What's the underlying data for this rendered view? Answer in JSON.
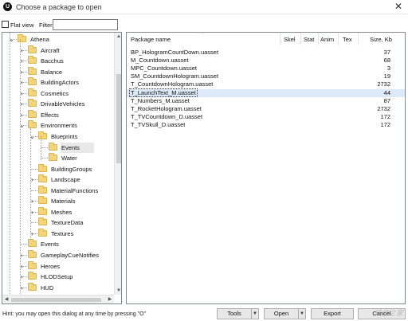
{
  "window": {
    "title": "Choose a package to open",
    "app_icon_glyph": "U"
  },
  "toolbar": {
    "flat_view_label": "Flat view",
    "flat_view_checked": false,
    "filter_label": "Filter",
    "filter_value": ""
  },
  "tree": {
    "items": [
      {
        "label": "Athena",
        "depth": 0,
        "expander": "expanded"
      },
      {
        "label": "Aircraft",
        "depth": 1,
        "expander": "collapsed"
      },
      {
        "label": "Bacchus",
        "depth": 1,
        "expander": "collapsed"
      },
      {
        "label": "Balance",
        "depth": 1,
        "expander": "collapsed"
      },
      {
        "label": "BuildingActors",
        "depth": 1,
        "expander": "collapsed"
      },
      {
        "label": "Cosmetics",
        "depth": 1,
        "expander": "collapsed"
      },
      {
        "label": "DrivableVehicles",
        "depth": 1,
        "expander": "collapsed"
      },
      {
        "label": "Effects",
        "depth": 1,
        "expander": "collapsed"
      },
      {
        "label": "Environments",
        "depth": 1,
        "expander": "expanded"
      },
      {
        "label": "Blueprints",
        "depth": 2,
        "expander": "expanded"
      },
      {
        "label": "Events",
        "depth": 3,
        "expander": "none",
        "selected": true
      },
      {
        "label": "Water",
        "depth": 3,
        "expander": "none"
      },
      {
        "label": "BuildingGroups",
        "depth": 2,
        "expander": "none"
      },
      {
        "label": "Landscape",
        "depth": 2,
        "expander": "collapsed"
      },
      {
        "label": "MaterialFunctions",
        "depth": 2,
        "expander": "none"
      },
      {
        "label": "Materials",
        "depth": 2,
        "expander": "collapsed"
      },
      {
        "label": "Meshes",
        "depth": 2,
        "expander": "collapsed"
      },
      {
        "label": "TextureData",
        "depth": 2,
        "expander": "none"
      },
      {
        "label": "Textures",
        "depth": 2,
        "expander": "collapsed"
      },
      {
        "label": "Events",
        "depth": 1,
        "expander": "none"
      },
      {
        "label": "GameplayCueNotifies",
        "depth": 1,
        "expander": "collapsed"
      },
      {
        "label": "Heroes",
        "depth": 1,
        "expander": "collapsed"
      },
      {
        "label": "HLODSetup",
        "depth": 1,
        "expander": "collapsed"
      },
      {
        "label": "HUD",
        "depth": 1,
        "expander": "collapsed"
      }
    ]
  },
  "list": {
    "columns": {
      "name": "Package name",
      "skel": "Skel",
      "stat": "Stat",
      "anim": "Anim",
      "tex": "Tex",
      "size": "Size, Kb"
    },
    "rows": [
      {
        "name": "BP_HologramCountDown.uasset",
        "size": "37"
      },
      {
        "name": "M_Countdown.uasset",
        "size": "68"
      },
      {
        "name": "MPC_Countdown.uasset",
        "size": "3"
      },
      {
        "name": "SM_CountdownHologram.uasset",
        "size": "19"
      },
      {
        "name": "T_CountdownHologram.uasset",
        "size": "2732"
      },
      {
        "name": "T_LaunchText_M.uasset",
        "size": "44",
        "selected": true
      },
      {
        "name": "T_Numbers_M.uasset",
        "size": "87"
      },
      {
        "name": "T_RocketHologram.uasset",
        "size": "2732"
      },
      {
        "name": "T_TVCountdown_D.uasset",
        "size": "172"
      },
      {
        "name": "T_TVSkull_D.uasset",
        "size": "172"
      }
    ]
  },
  "bottom": {
    "hint": "Hint: you may open this dialog at any time by pressing \"O\"",
    "tools_label": "Tools",
    "open_label": "Open",
    "export_label": "Export",
    "cancel_label": "Cancel",
    "watermark": "插件之家"
  },
  "colors": {
    "folder": "#f4d57a",
    "selection": "#dceaf8",
    "tree_selection": "#e8e8e8"
  }
}
